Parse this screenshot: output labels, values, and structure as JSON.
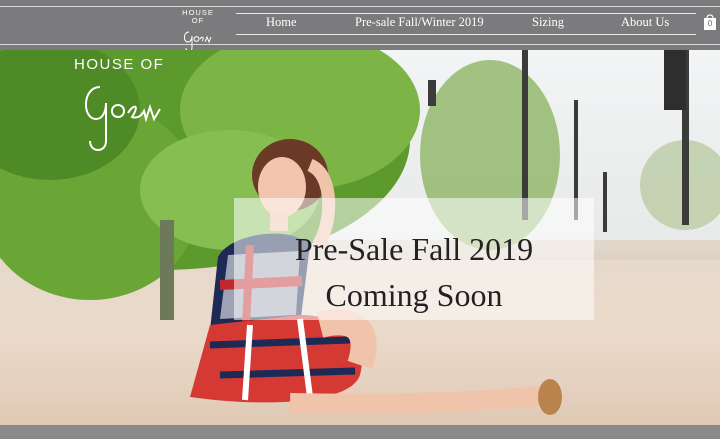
{
  "brand": {
    "top": "HOUSE OF",
    "script": "Goen"
  },
  "nav": {
    "items": [
      {
        "label": "Home"
      },
      {
        "label": "Pre-sale Fall/Winter 2019"
      },
      {
        "label": "Sizing"
      },
      {
        "label": "About Us"
      }
    ]
  },
  "cart": {
    "count": "0"
  },
  "hero": {
    "line1": "Pre-Sale Fall 2019",
    "line2": "Coming Soon"
  },
  "colors": {
    "header": "#7b7b7d",
    "text": "#ffffff"
  }
}
